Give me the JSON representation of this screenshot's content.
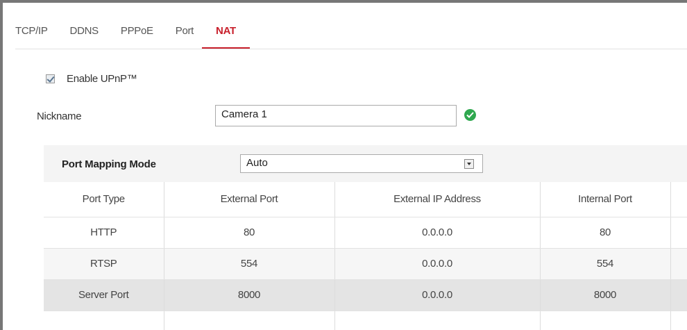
{
  "tabs": [
    {
      "label": "TCP/IP",
      "active": false
    },
    {
      "label": "DDNS",
      "active": false
    },
    {
      "label": "PPPoE",
      "active": false
    },
    {
      "label": "Port",
      "active": false
    },
    {
      "label": "NAT",
      "active": true
    }
  ],
  "upnp": {
    "label": "Enable UPnP™",
    "checked": true
  },
  "nickname": {
    "label": "Nickname",
    "value": "Camera 1"
  },
  "mapping": {
    "label": "Port Mapping Mode",
    "selected": "Auto"
  },
  "table": {
    "headers": [
      "Port Type",
      "External Port",
      "External IP Address",
      "Internal Port",
      ""
    ],
    "rows": [
      [
        "HTTP",
        "80",
        "0.0.0.0",
        "80",
        ""
      ],
      [
        "RTSP",
        "554",
        "0.0.0.0",
        "554",
        ""
      ],
      [
        "Server Port",
        "8000",
        "0.0.0.0",
        "8000",
        ""
      ]
    ]
  },
  "colors": {
    "accent": "#c8202c",
    "ok": "#2fa84f"
  },
  "icons": {
    "ok": "check-circle-icon",
    "dropdown": "chevron-down-icon",
    "checkbox": "checkbox-checked-icon"
  }
}
